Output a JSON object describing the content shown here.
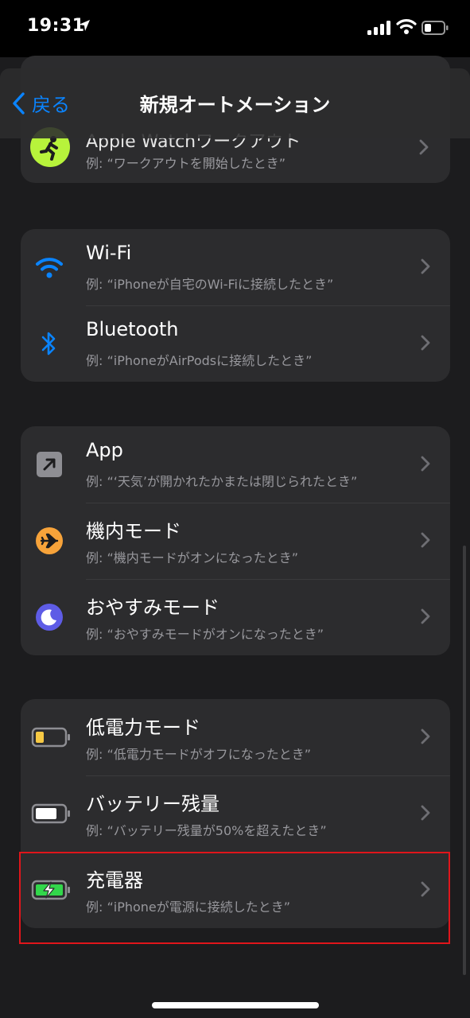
{
  "status_bar": {
    "time": "19:31"
  },
  "nav": {
    "back_label": "戻る",
    "title": "新規オートメーション"
  },
  "partial_row": {
    "title": "Apple Watchワークアウト",
    "subtitle": "例: “ワークアウトを開始したとき”"
  },
  "groups": [
    {
      "items": [
        {
          "id": "wifi",
          "icon": "wifi-icon",
          "title": "Wi-Fi",
          "subtitle": "例: “iPhoneが自宅のWi-Fiに接続したとき”"
        },
        {
          "id": "bluetooth",
          "icon": "bluetooth-icon",
          "title": "Bluetooth",
          "subtitle": "例: “iPhoneがAirPodsに接続したとき”"
        }
      ]
    },
    {
      "items": [
        {
          "id": "app",
          "icon": "app-arrow-icon",
          "title": "App",
          "subtitle": "例: “‘天気’が開かれたかまたは閉じられたとき”"
        },
        {
          "id": "airplane",
          "icon": "airplane-icon",
          "title": "機内モード",
          "subtitle": "例: “機内モードがオンになったとき”"
        },
        {
          "id": "dnd",
          "icon": "moon-icon",
          "title": "おやすみモード",
          "subtitle": "例: “おやすみモードがオンになったとき”"
        }
      ]
    },
    {
      "items": [
        {
          "id": "lowpower",
          "icon": "low-power-battery-icon",
          "title": "低電力モード",
          "subtitle": "例: “低電力モードがオフになったとき”"
        },
        {
          "id": "battery",
          "icon": "battery-icon",
          "title": "バッテリー残量",
          "subtitle": "例: “バッテリー残量が50%を超えたとき”"
        },
        {
          "id": "charger",
          "icon": "charging-battery-icon",
          "title": "充電器",
          "subtitle": "例: “iPhoneが電源に接続したとき”"
        }
      ]
    }
  ],
  "colors": {
    "accent": "#0a84ff",
    "highlight": "#e0151b",
    "airplane": "#f7a33a",
    "moon": "#5e5ce6",
    "lowpower": "#f7c944",
    "charging": "#32d74b"
  }
}
